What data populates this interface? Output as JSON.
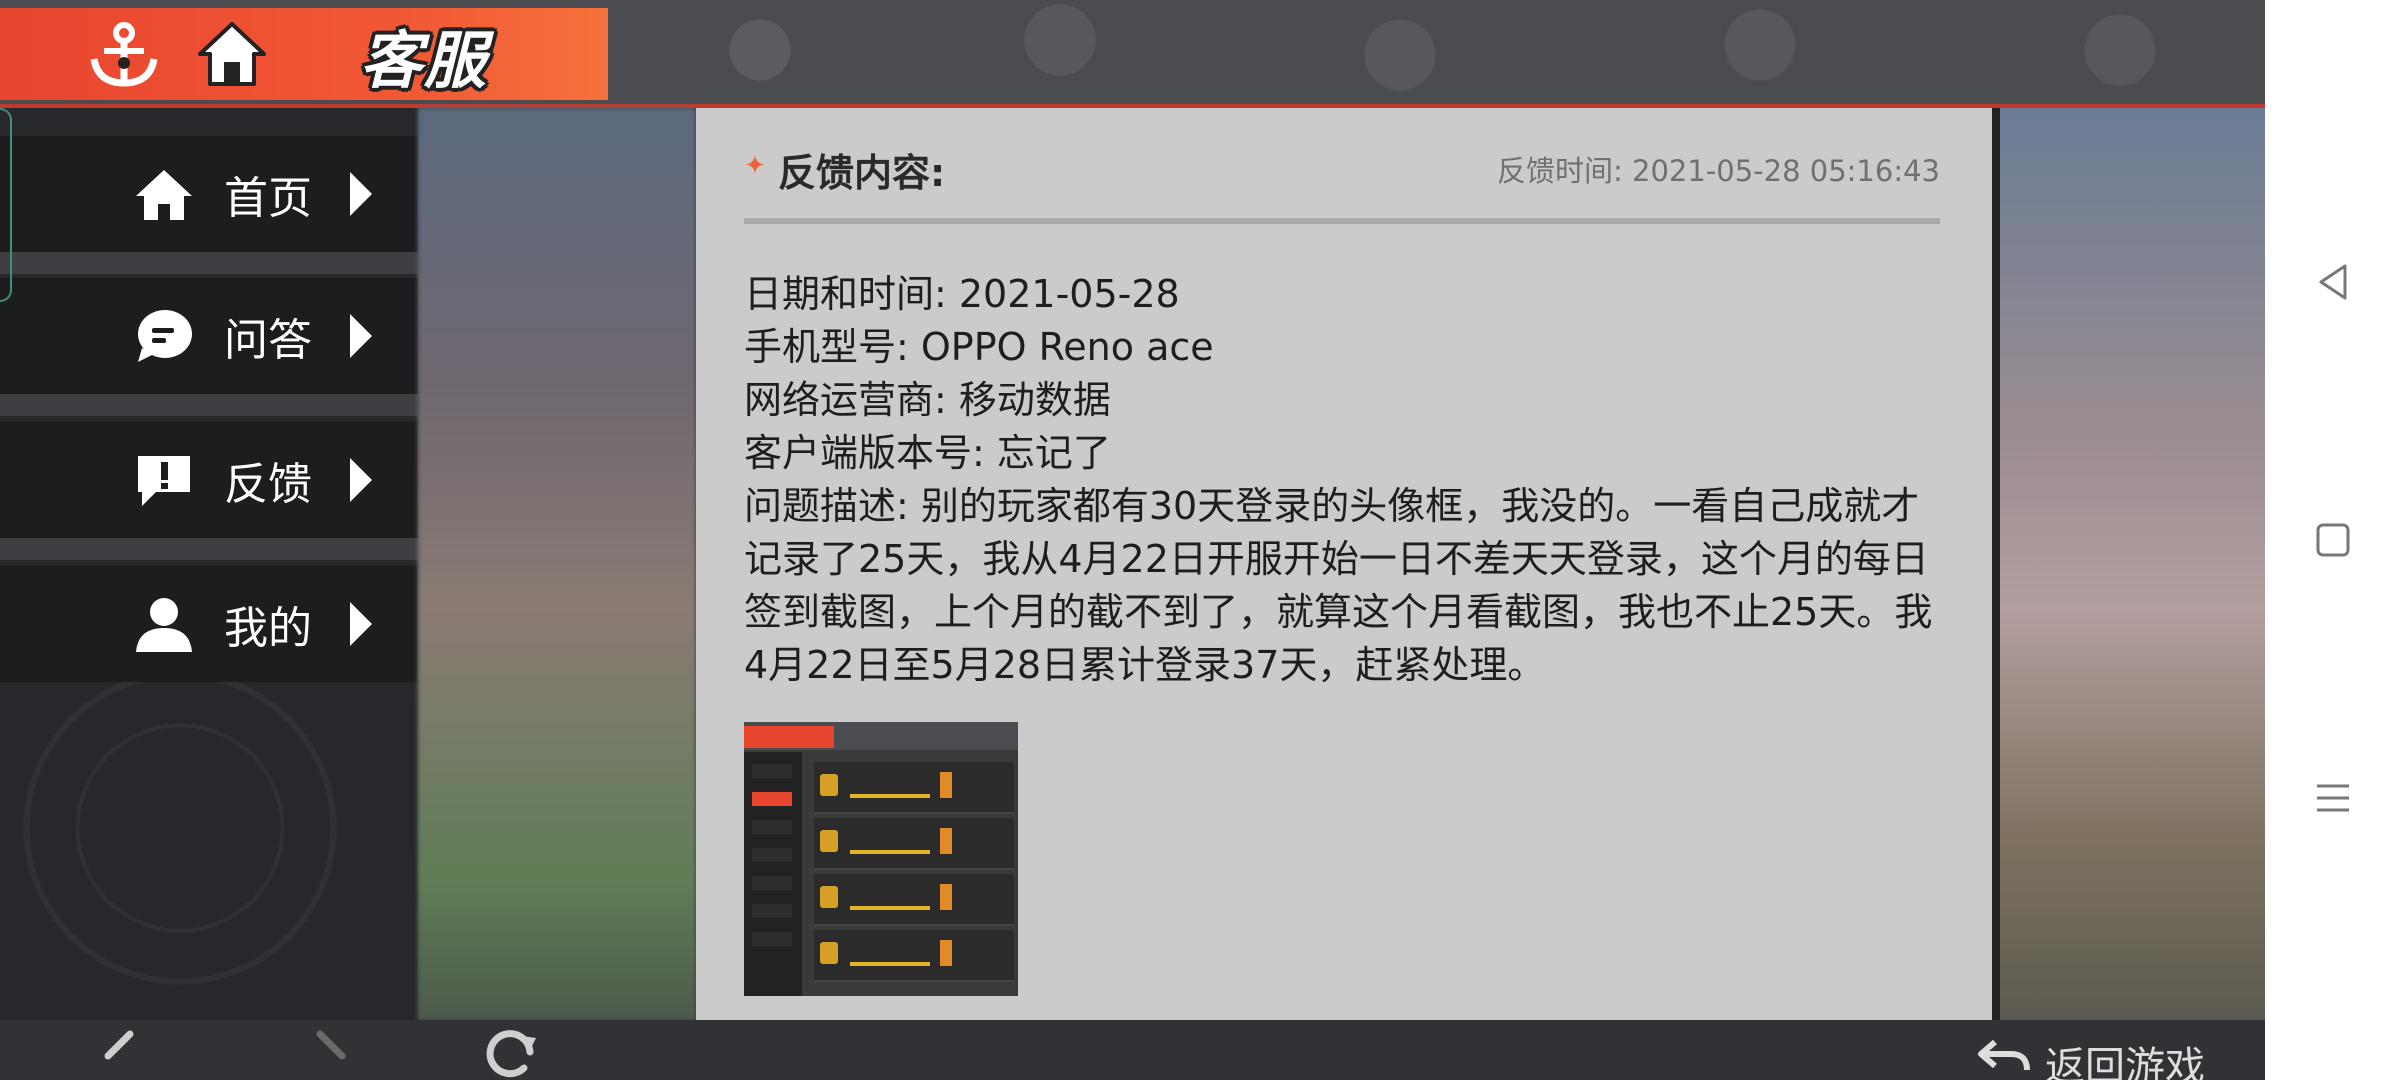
{
  "header": {
    "title": "客服",
    "icons": [
      "anchor-icon",
      "home-icon"
    ]
  },
  "sidebar": {
    "items": [
      {
        "label": "首页",
        "icon": "home-icon"
      },
      {
        "label": "问答",
        "icon": "chat-bubble-icon"
      },
      {
        "label": "反馈",
        "icon": "exclamation-icon"
      },
      {
        "label": "我的",
        "icon": "user-icon"
      }
    ]
  },
  "card": {
    "title": "反馈内容:",
    "time": "反馈时间: 2021-05-28 05:16:43",
    "lines": [
      "日期和时间: 2021-05-28",
      "手机型号: OPPO Reno ace",
      "网络运营商: 移动数据",
      "客户端版本号: 忘记了"
    ],
    "description": "问题描述: 别的玩家都有30天登录的头像框，我没的。一看自己成就才记录了25天，我从4月22日开服开始一日不差天天登录，这个月的每日签到截图，上个月的截不到了，就算这个月看截图，我也不止25天。我4月22日至5月28日累计登录37天，赶紧处理。"
  },
  "bottom": {
    "back_to_game": "返回游戏"
  },
  "colors": {
    "accent": "#f15a35",
    "card_bg": "#cbcbcb",
    "sidebar_bg": "#1c1d1f"
  }
}
